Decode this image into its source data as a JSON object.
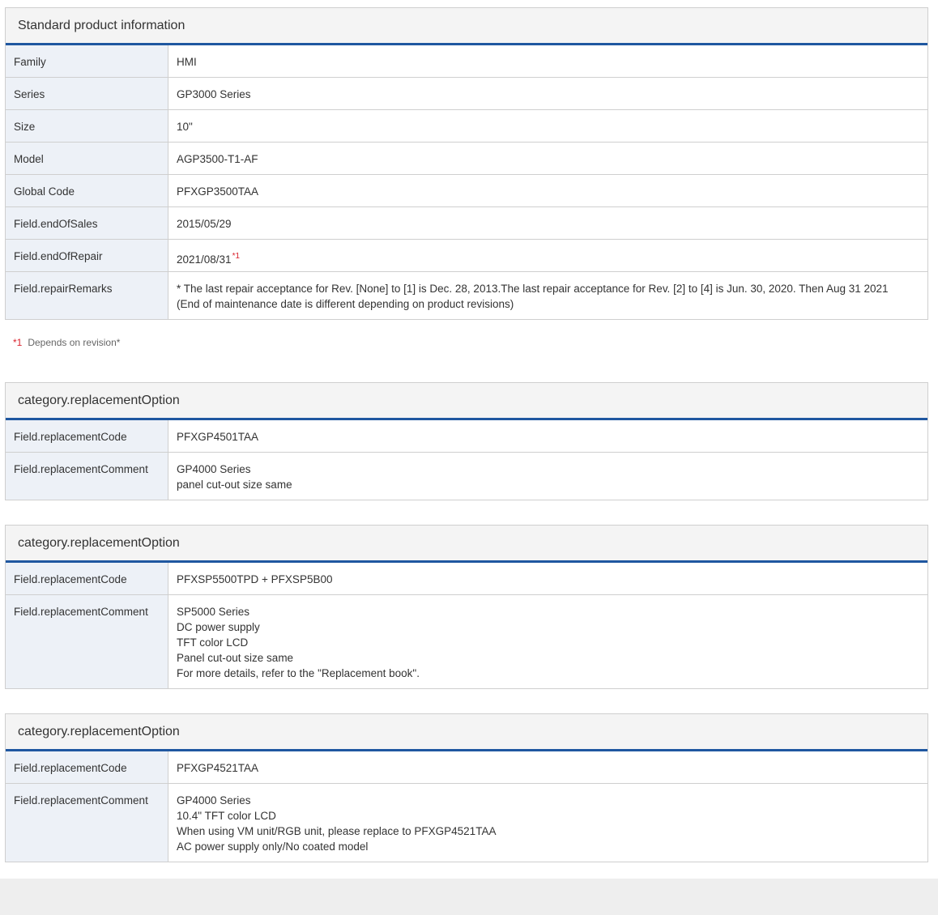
{
  "standard": {
    "title": "Standard product information",
    "rows": [
      {
        "label": "Family",
        "value": "HMI"
      },
      {
        "label": "Series",
        "value": "GP3000 Series"
      },
      {
        "label": "Size",
        "value": "10\""
      },
      {
        "label": "Model",
        "value": "AGP3500-T1-AF"
      },
      {
        "label": "Global Code",
        "value": "PFXGP3500TAA"
      },
      {
        "label": "Field.endOfSales",
        "value": "2015/05/29"
      },
      {
        "label": "Field.endOfRepair",
        "value": "2021/08/31",
        "sup": "*1"
      },
      {
        "label": "Field.repairRemarks",
        "value": "* The last repair acceptance for Rev. [None] to [1] is Dec. 28, 2013.The last repair acceptance for Rev. [2] to [4] is Jun. 30, 2020. Then Aug 31 2021\n(End of maintenance date is different depending on product revisions)"
      }
    ]
  },
  "footnote": {
    "mark": "*1",
    "text": "Depends on revision*"
  },
  "options": [
    {
      "title": "category.replacementOption",
      "rows": [
        {
          "label": "Field.replacementCode",
          "value": "PFXGP4501TAA"
        },
        {
          "label": "Field.replacementComment",
          "value": "GP4000 Series\npanel cut-out size same"
        }
      ]
    },
    {
      "title": "category.replacementOption",
      "rows": [
        {
          "label": "Field.replacementCode",
          "value": "PFXSP5500TPD + PFXSP5B00"
        },
        {
          "label": "Field.replacementComment",
          "value": "SP5000 Series\nDC power supply\nTFT color LCD\nPanel cut-out size same\nFor more details, refer to the \"Replacement book\"."
        }
      ]
    },
    {
      "title": "category.replacementOption",
      "rows": [
        {
          "label": "Field.replacementCode",
          "value": "PFXGP4521TAA"
        },
        {
          "label": "Field.replacementComment",
          "value": "GP4000 Series\n10.4\" TFT color LCD\nWhen using VM unit/RGB unit, please replace to PFXGP4521TAA\nAC power supply only/No coated model"
        }
      ]
    }
  ],
  "colors": {
    "accent_rule": "#1f57a0",
    "footnote_mark": "#d9232d",
    "label_bg": "#edf1f7",
    "header_bg": "#f4f4f4"
  }
}
